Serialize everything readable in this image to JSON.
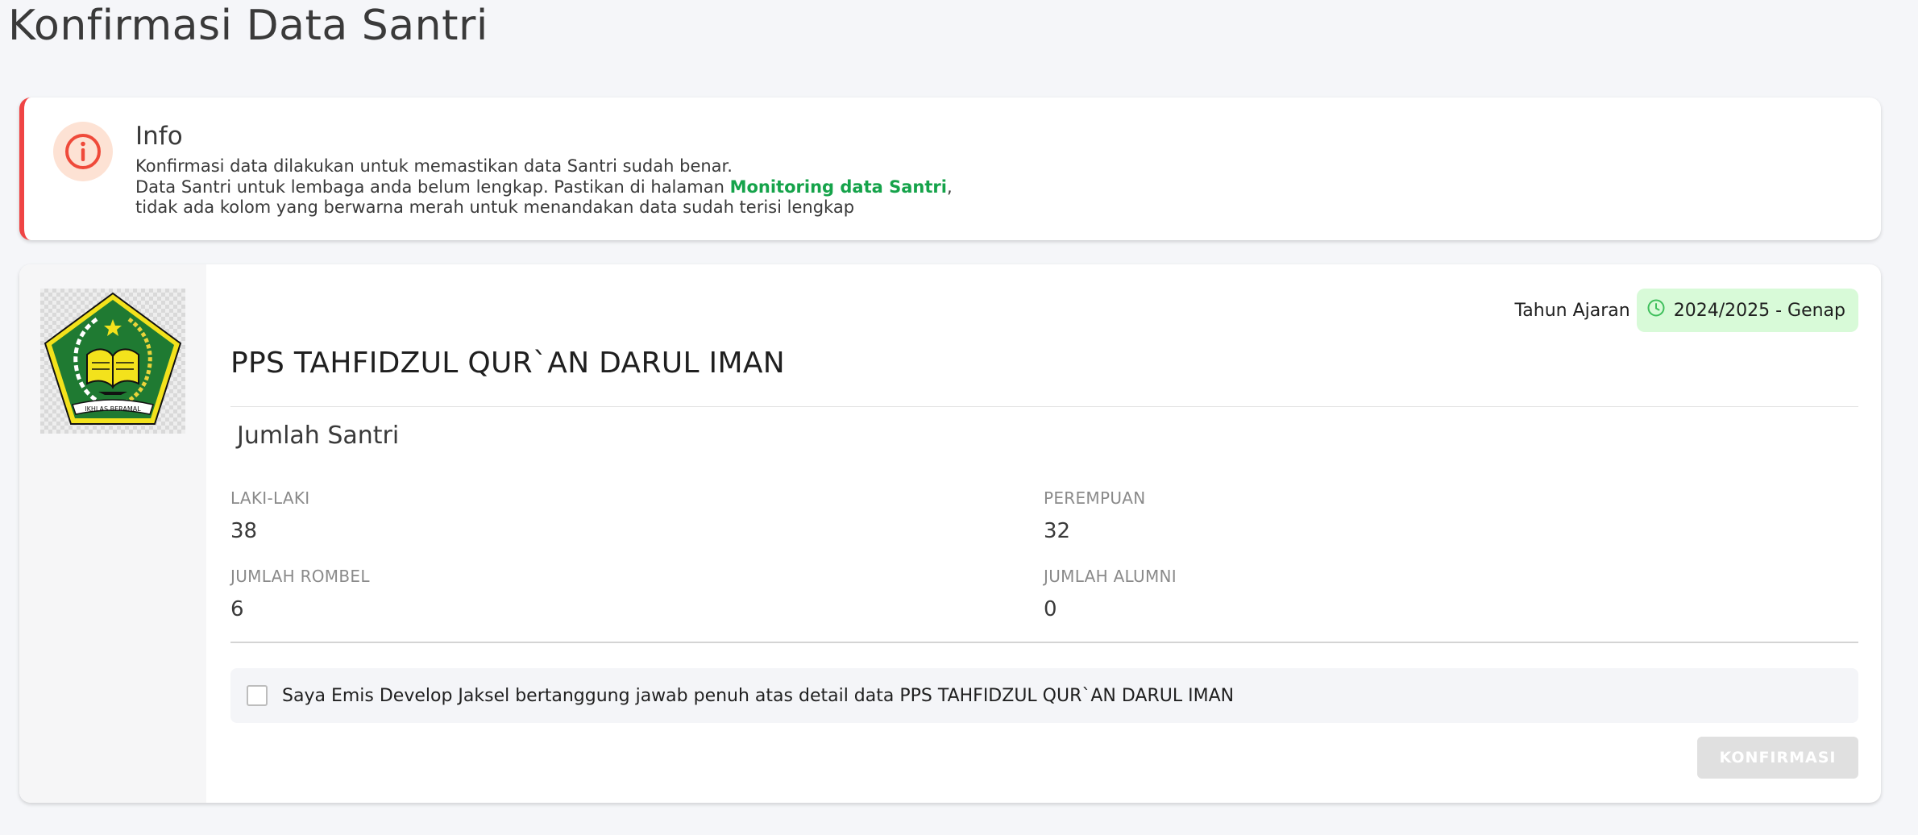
{
  "page": {
    "title": "Konfirmasi Data Santri"
  },
  "info": {
    "title": "Info",
    "line1": "Konfirmasi data dilakukan untuk memastikan data Santri sudah benar.",
    "line2_prefix": "Data Santri untuk lembaga anda belum lengkap. Pastikan di halaman ",
    "line2_link": "Monitoring data Santri",
    "line2_suffix": ",",
    "line3": "tidak ada kolom yang berwarna merah untuk menandakan data sudah terisi lengkap",
    "icon": "info-circle-icon",
    "accent_color": "#ef4444",
    "link_color": "#15a34a"
  },
  "institution": {
    "name": "PPS TAHFIDZUL QUR`AN DARUL IMAN",
    "logo_text": "IKHLAS BERAMAL",
    "academic_year_label": "Tahun Ajaran",
    "academic_year": "2024/2025 - Genap",
    "badge_color": "#d8fad8"
  },
  "stats": {
    "section_title": "Jumlah Santri",
    "male_label": "LAKI-LAKI",
    "male_value": "38",
    "female_label": "PEREMPUAN",
    "female_value": "32",
    "rombel_label": "JUMLAH ROMBEL",
    "rombel_value": "6",
    "alumni_label": "JUMLAH ALUMNI",
    "alumni_value": "0"
  },
  "agreement": {
    "text": "Saya Emis Develop Jaksel bertanggung jawab penuh atas detail data PPS TAHFIDZUL QUR`AN DARUL IMAN",
    "checked": false
  },
  "actions": {
    "confirm_label": "KONFIRMASI",
    "confirm_disabled": true
  }
}
